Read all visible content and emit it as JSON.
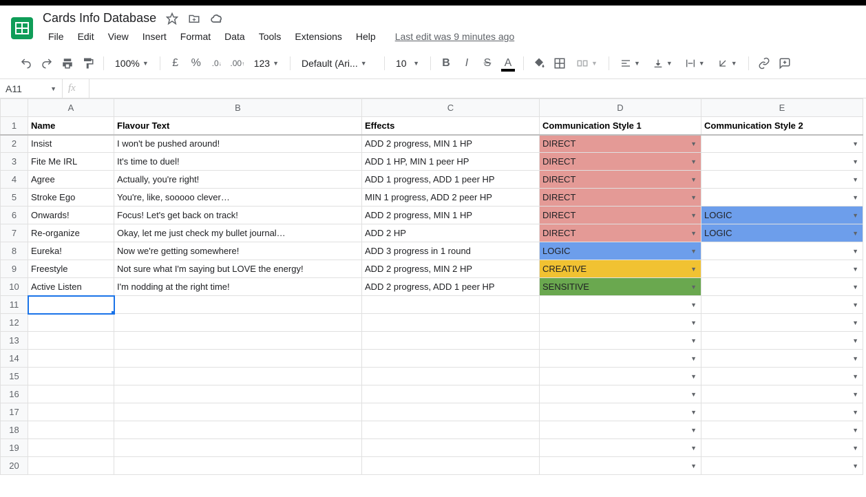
{
  "doc_title": "Cards Info Database",
  "last_edit": "Last edit was 9 minutes ago",
  "menu": {
    "file": "File",
    "edit": "Edit",
    "view": "View",
    "insert": "Insert",
    "format": "Format",
    "data": "Data",
    "tools": "Tools",
    "extensions": "Extensions",
    "help": "Help"
  },
  "toolbar": {
    "zoom": "100%",
    "currency": "£",
    "percent": "%",
    "dec_dec": ".0",
    "inc_dec": ".00",
    "numfmt": "123",
    "font": "Default (Ari...",
    "font_size": "10"
  },
  "namebox": "A11",
  "fx_label": "fx",
  "columns": {
    "A": "A",
    "B": "B",
    "C": "C",
    "D": "D",
    "E": "E"
  },
  "headers": {
    "name": "Name",
    "flavour": "Flavour Text",
    "effects": "Effects",
    "cs1": "Communication Style 1",
    "cs2": "Communication Style 2"
  },
  "styles": {
    "DIRECT": "bg-direct",
    "LOGIC": "bg-logic",
    "CREATIVE": "bg-creative",
    "SENSITIVE": "bg-sensitive"
  },
  "rows": [
    {
      "n": "Insist",
      "f": "I won't be pushed around!",
      "e": "ADD 2 progress, MIN 1 HP",
      "c1": "DIRECT",
      "c2": ""
    },
    {
      "n": "Fite Me IRL",
      "f": "It's time to duel!",
      "e": "ADD 1 HP, MIN 1 peer HP",
      "c1": "DIRECT",
      "c2": ""
    },
    {
      "n": "Agree",
      "f": "Actually, you're right!",
      "e": "ADD 1 progress, ADD 1 peer HP",
      "c1": "DIRECT",
      "c2": ""
    },
    {
      "n": "Stroke Ego",
      "f": "You're, like, sooooo clever…",
      "e": "MIN 1 progress, ADD 2 peer HP",
      "c1": "DIRECT",
      "c2": ""
    },
    {
      "n": "Onwards!",
      "f": "Focus! Let's get back on track!",
      "e": "ADD 2 progress, MIN 1 HP",
      "c1": "DIRECT",
      "c2": "LOGIC"
    },
    {
      "n": "Re-organize",
      "f": "Okay, let me just check my bullet journal…",
      "e": "ADD 2 HP",
      "c1": "DIRECT",
      "c2": "LOGIC"
    },
    {
      "n": "Eureka!",
      "f": "Now we're getting somewhere!",
      "e": "ADD 3 progress in 1 round",
      "c1": "LOGIC",
      "c2": ""
    },
    {
      "n": "Freestyle",
      "f": "Not sure what I'm saying but LOVE the energy!",
      "e": "ADD 2 progress, MIN 2 HP",
      "c1": "CREATIVE",
      "c2": ""
    },
    {
      "n": "Active Listen",
      "f": "I'm nodding at the right time!",
      "e": "ADD 2 progress, ADD 1 peer HP",
      "c1": "SENSITIVE",
      "c2": ""
    }
  ],
  "empty_rows": 10,
  "selected_row": 11
}
